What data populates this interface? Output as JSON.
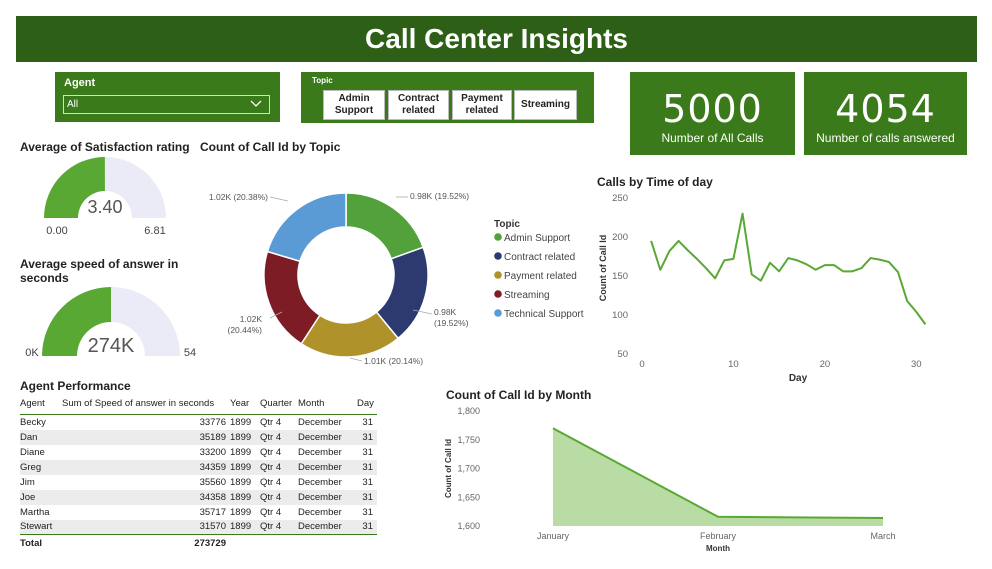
{
  "header": {
    "title": "Call Center Insights"
  },
  "agent_slicer": {
    "label": "Agent",
    "value": "All"
  },
  "topic_slicer": {
    "label": "Topic",
    "buttons": [
      {
        "line1": "Admin",
        "line2": "Support"
      },
      {
        "line1": "Contract",
        "line2": "related"
      },
      {
        "line1": "Payment",
        "line2": "related"
      },
      {
        "line1": "Streaming",
        "line2": ""
      }
    ]
  },
  "cards": [
    {
      "value": "5000",
      "caption": "Number of All Calls"
    },
    {
      "value": "4054",
      "caption": "Number of calls answered"
    }
  ],
  "colors": {
    "green": "#5aa834",
    "track": "#ebebf7",
    "admin_support": "#52a13a",
    "contract_related": "#2c3a70",
    "payment_related": "#b0922a",
    "streaming": "#7d1c25",
    "technical_support": "#5b9bd5",
    "area_fill": "#b9dca5",
    "line": "#5aa834"
  },
  "chart_data": [
    {
      "type": "gauge",
      "title": "Average of Satisfaction rating",
      "value": 3.4,
      "value_label": "3.40",
      "min": 0,
      "min_label": "0.00",
      "max": 6.81,
      "max_label": "6.81"
    },
    {
      "type": "gauge",
      "title": "Average speed of answer in seconds",
      "title_line1": "Average speed of answer in",
      "title_line2": "seconds",
      "value": 273729,
      "value_label": "274K",
      "min": 0,
      "min_label": "0K",
      "max": 547458,
      "max_label": "54"
    },
    {
      "type": "pie",
      "title": "Count of Call Id by Topic",
      "legend_title": "Topic",
      "legend_position": "right",
      "slices": [
        {
          "name": "Admin Support",
          "value": 976,
          "percent": 19.52,
          "label": "0.98K (19.52%)"
        },
        {
          "name": "Contract related",
          "value": 976,
          "percent": 19.52,
          "label": "0.98K",
          "label2": "(19.52%)"
        },
        {
          "name": "Payment related",
          "value": 1007,
          "percent": 20.14,
          "label": "1.01K (20.14%)"
        },
        {
          "name": "Streaming",
          "value": 1022,
          "percent": 20.44,
          "label": "1.02K",
          "label2": "(20.44%)"
        },
        {
          "name": "Technical Support",
          "value": 1019,
          "percent": 20.38,
          "label": "1.02K (20.38%)"
        }
      ]
    },
    {
      "type": "line",
      "title": "Calls by Time of day",
      "xlabel": "Day",
      "ylabel": "Count of Call Id",
      "xlim": [
        0,
        31.5
      ],
      "ylim": [
        50,
        250
      ],
      "xticks": [
        0,
        10,
        20,
        30
      ],
      "yticks": [
        50,
        100,
        150,
        200,
        250
      ],
      "x": [
        1,
        2,
        3,
        4,
        5,
        6,
        7,
        8,
        9,
        10,
        11,
        12,
        13,
        14,
        15,
        16,
        17,
        18,
        19,
        20,
        21,
        22,
        23,
        24,
        25,
        26,
        27,
        28,
        29,
        30,
        31
      ],
      "y": [
        195,
        158,
        182,
        195,
        183,
        172,
        160,
        147,
        170,
        172,
        230,
        152,
        144,
        167,
        156,
        173,
        170,
        165,
        158,
        164,
        164,
        156,
        156,
        160,
        173,
        171,
        168,
        155,
        118,
        104,
        88
      ]
    },
    {
      "type": "area",
      "title": "Count of Call Id by Month",
      "xlabel": "Month",
      "ylabel": "Count of Call Id",
      "categories": [
        "January",
        "February",
        "March"
      ],
      "values": [
        1770,
        1616,
        1614
      ],
      "ylim": [
        1600,
        1800
      ],
      "yticks": [
        1600,
        1650,
        1700,
        1750,
        1800
      ],
      "ytick_labels": [
        "1,600",
        "1,650",
        "1,700",
        "1,750",
        "1,800"
      ]
    },
    {
      "type": "table",
      "title": "Agent Performance",
      "columns": [
        "Agent",
        "Sum of Speed of answer in seconds",
        "Year",
        "Quarter",
        "Month",
        "Day"
      ],
      "rows": [
        [
          "Becky",
          "33776",
          "1899",
          "Qtr 4",
          "December",
          "31"
        ],
        [
          "Dan",
          "35189",
          "1899",
          "Qtr 4",
          "December",
          "31"
        ],
        [
          "Diane",
          "33200",
          "1899",
          "Qtr 4",
          "December",
          "31"
        ],
        [
          "Greg",
          "34359",
          "1899",
          "Qtr 4",
          "December",
          "31"
        ],
        [
          "Jim",
          "35560",
          "1899",
          "Qtr 4",
          "December",
          "31"
        ],
        [
          "Joe",
          "34358",
          "1899",
          "Qtr 4",
          "December",
          "31"
        ],
        [
          "Martha",
          "35717",
          "1899",
          "Qtr 4",
          "December",
          "31"
        ],
        [
          "Stewart",
          "31570",
          "1899",
          "Qtr 4",
          "December",
          "31"
        ]
      ],
      "total": [
        "Total",
        "273729",
        "",
        "",
        "",
        ""
      ]
    }
  ]
}
